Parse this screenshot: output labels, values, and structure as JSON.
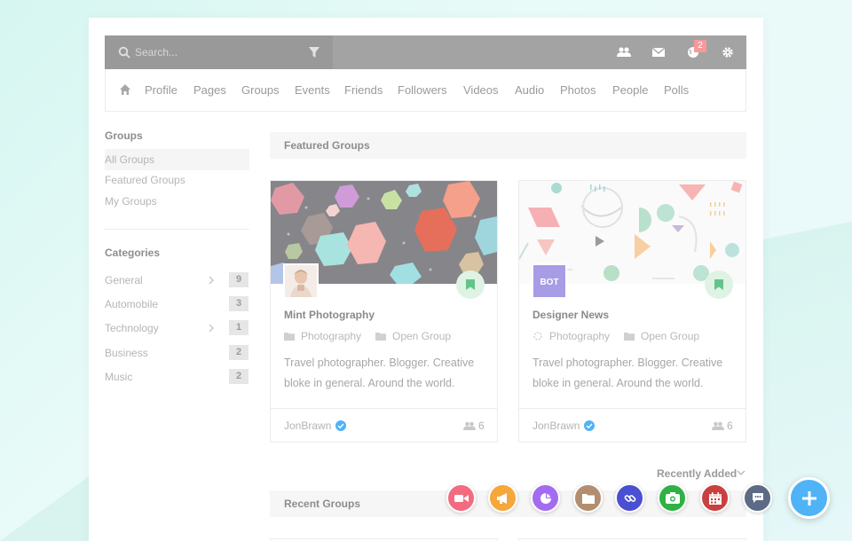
{
  "colors": {
    "fab_video": "#f36b7f",
    "fab_announce": "#f5a73b",
    "fab_poll": "#a36cf0",
    "fab_folder": "#b38d6f",
    "fab_link": "#4b4fd2",
    "fab_photo": "#2fb145",
    "fab_event": "#c84040",
    "fab_chat": "#5c6a85",
    "fab_main": "#4fb3f7",
    "verified": "#4fb3f7",
    "bookmark": "#63c48a",
    "badge": "#f59a9a"
  },
  "search": {
    "placeholder": "Search..."
  },
  "topbar": {
    "notification_count": "2"
  },
  "nav": [
    "Profile",
    "Pages",
    "Groups",
    "Events",
    "Friends",
    "Followers",
    "Videos",
    "Audio",
    "Photos",
    "People",
    "Polls"
  ],
  "sidebar": {
    "groups_heading": "Groups",
    "group_links": [
      "All Groups",
      "Featured Groups",
      "My Groups"
    ],
    "categories_heading": "Categories",
    "categories": [
      {
        "name": "General",
        "count": "9",
        "has_children": true
      },
      {
        "name": "Automobile",
        "count": "3",
        "has_children": false
      },
      {
        "name": "Technology",
        "count": "1",
        "has_children": true
      },
      {
        "name": "Business",
        "count": "2",
        "has_children": false
      },
      {
        "name": "Music",
        "count": "2",
        "has_children": false
      }
    ]
  },
  "featured": {
    "heading": "Featured Groups",
    "cards": [
      {
        "title": "Mint Photography",
        "category": "Photography",
        "privacy": "Open Group",
        "description": "Travel photographer. Blogger. Creative bloke in general. Around the world.",
        "author": "JonBrawn",
        "members": "6"
      },
      {
        "title": "Designer News",
        "avatar_text": "BOT",
        "category": "Photography",
        "privacy": "Open Group",
        "description": "Travel photographer. Blogger. Creative bloke in general. Around the world.",
        "author": "JonBrawn",
        "members": "6"
      }
    ]
  },
  "sort": {
    "label": "Recently Added"
  },
  "recent": {
    "heading": "Recent Groups"
  }
}
